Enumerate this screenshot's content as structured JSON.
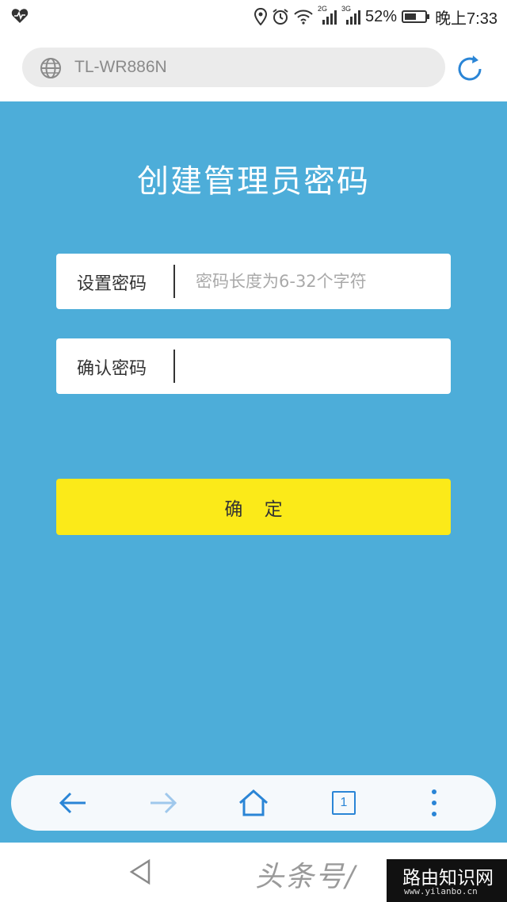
{
  "status_bar": {
    "network_2g": "2G",
    "network_3g": "3G",
    "battery": "52%",
    "time": "晚上7:33",
    "icons": [
      "health-icon",
      "location-icon",
      "alarm-icon",
      "wifi-icon",
      "signal-icon",
      "battery-icon"
    ]
  },
  "address_bar": {
    "url": "TL-WR886N",
    "icons": [
      "globe-icon",
      "refresh-icon"
    ]
  },
  "page": {
    "title": "创建管理员密码",
    "fields": [
      {
        "label": "设置密码",
        "value": "",
        "placeholder": "密码长度为6-32个字符"
      },
      {
        "label": "确认密码",
        "value": "",
        "placeholder": ""
      }
    ],
    "confirm_label": "确 定"
  },
  "toolbar": {
    "tab_count": "1",
    "icons": [
      "back-arrow-icon",
      "forward-arrow-icon",
      "home-icon",
      "tabs-icon",
      "more-vertical-icon"
    ]
  },
  "watermark": {
    "text": "头条号/",
    "badge_title": "路由知识网",
    "badge_site": "www.yilanbo.cn"
  },
  "colors": {
    "background": "#4dadd9",
    "confirm_button": "#fbea19",
    "accent": "#2a85d6"
  }
}
